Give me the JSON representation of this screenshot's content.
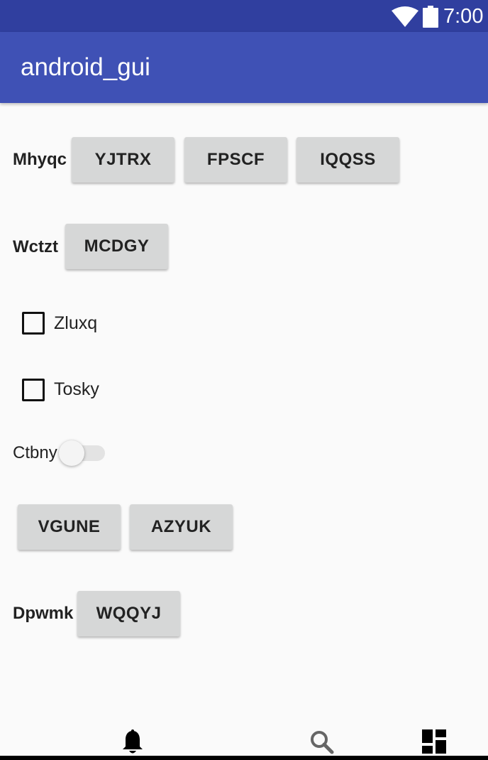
{
  "status_bar": {
    "time": "7:00",
    "icons": [
      "wifi-icon",
      "battery-icon"
    ]
  },
  "app_bar": {
    "title": "android_gui"
  },
  "rows": {
    "row1": {
      "label": "Mhyqc",
      "buttons": [
        "YJTRX",
        "FPSCF",
        "IQQSS"
      ]
    },
    "row2": {
      "label": "Wctzt",
      "buttons": [
        "MCDGY"
      ]
    },
    "checkbox1": {
      "label": "Zluxq",
      "checked": false
    },
    "checkbox2": {
      "label": "Tosky",
      "checked": false
    },
    "switch1": {
      "label": "Ctbny",
      "on": false
    },
    "row3": {
      "buttons": [
        "VGUNE",
        "AZYUK"
      ]
    },
    "row4": {
      "label": "Dpwmk",
      "buttons": [
        "WQQYJ"
      ]
    }
  },
  "bottom_nav": {
    "items": [
      "bell-icon",
      "search-icon",
      "dashboard-icon"
    ]
  },
  "colors": {
    "status_bar": "#303f9f",
    "app_bar": "#3f51b5",
    "background": "#fafafa",
    "button": "#d6d7d7"
  }
}
